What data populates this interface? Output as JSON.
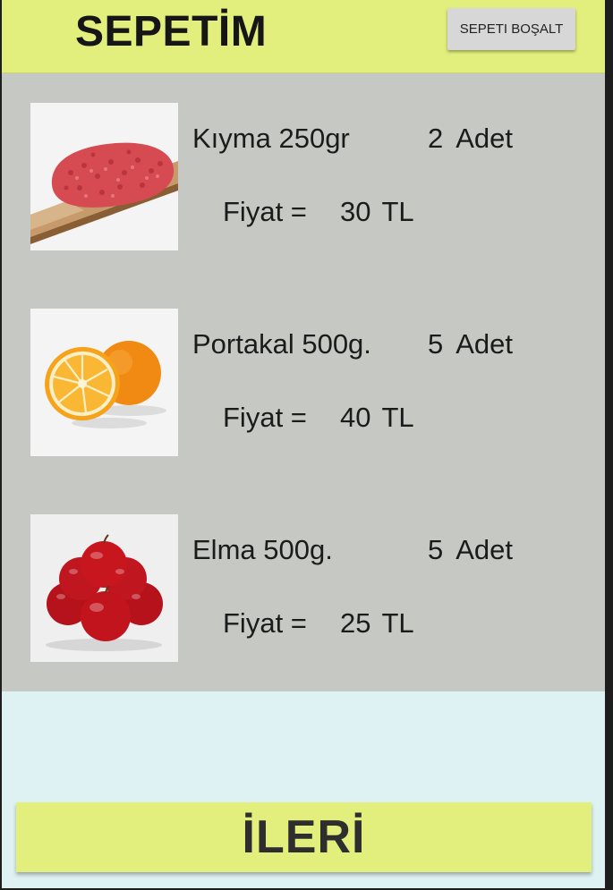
{
  "header": {
    "title": "SEPETİM",
    "clear_button": "SEPETI BOŞALT"
  },
  "items": [
    {
      "name": "Kıyma 250gr",
      "qty": "2",
      "qty_unit": "Adet",
      "price_label": "Fiyat =",
      "price": "30",
      "currency": "TL",
      "image": "minced-meat"
    },
    {
      "name": "Portakal 500g.",
      "qty": "5",
      "qty_unit": "Adet",
      "price_label": "Fiyat =",
      "price": "40",
      "currency": "TL",
      "image": "orange"
    },
    {
      "name": "Elma 500g.",
      "qty": "5",
      "qty_unit": "Adet",
      "price_label": "Fiyat =",
      "price": "25",
      "currency": "TL",
      "image": "apple"
    }
  ],
  "footer": {
    "next_button": "İLERİ"
  },
  "colors": {
    "accent": "#e2ef7c",
    "list_bg": "#c5c8c3",
    "page_bg": "#dff2f3"
  }
}
